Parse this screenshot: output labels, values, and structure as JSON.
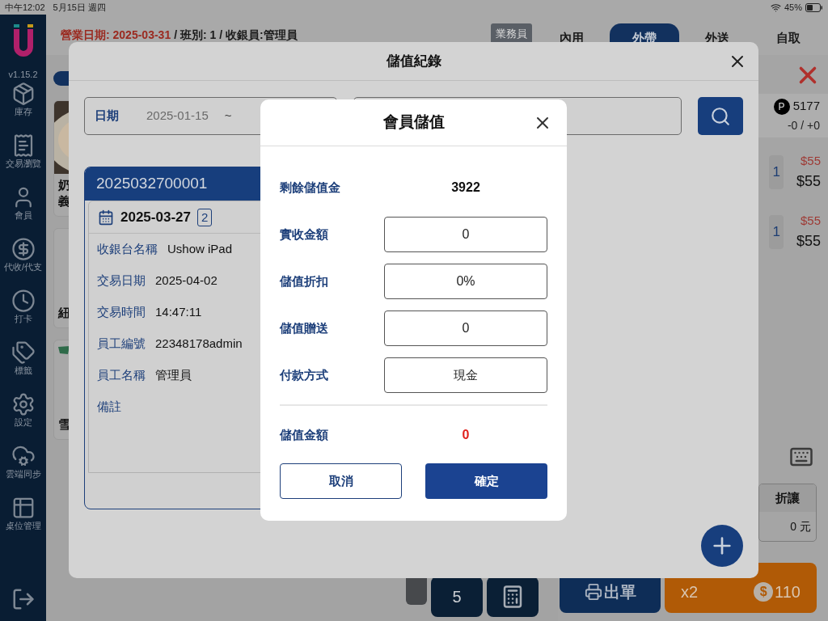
{
  "status_bar": {
    "time": "中午12:02",
    "date": "5月15日 週四",
    "battery": "45%"
  },
  "sidebar": {
    "version": "v1.15.2",
    "items": [
      {
        "label": "庫存",
        "kind": "stock"
      },
      {
        "label": "交易瀏覽",
        "kind": "receipt"
      },
      {
        "label": "會員",
        "kind": "member"
      },
      {
        "label": "代收/代支",
        "kind": "money"
      },
      {
        "label": "打卡",
        "kind": "clock"
      },
      {
        "label": "標籤",
        "kind": "tag"
      },
      {
        "label": "設定",
        "kind": "settings"
      },
      {
        "label": "雲端同步",
        "kind": "cloud"
      },
      {
        "label": "桌位管理",
        "kind": "table"
      }
    ]
  },
  "header": {
    "business_date": "營業日期: 2025-03-31",
    "info": "/ 班別: 1 / 收銀員:管理員",
    "staff_button": "業務員",
    "tabs": [
      {
        "label": "內用",
        "selected": false
      },
      {
        "label": "外帶",
        "selected": true
      },
      {
        "label": "外送",
        "selected": false
      },
      {
        "label": "自取",
        "selected": false
      }
    ]
  },
  "products": [
    {
      "kind": "picture",
      "lines": [
        "奶",
        "義"
      ]
    },
    {
      "kind": "plain",
      "lines": [
        "紐"
      ]
    },
    {
      "kind": "logo",
      "lines": [
        "雪"
      ]
    }
  ],
  "order": {
    "points_badge": "P",
    "points": "5177",
    "points_change": "-0 / +0",
    "items": [
      {
        "qty": "1",
        "original_price": "$55",
        "price": "$55"
      },
      {
        "qty": "1",
        "original_price": "$55",
        "price": "$55"
      }
    ],
    "discount": {
      "label": "折讓",
      "value": "0 元"
    },
    "print_button": "出單",
    "checkout": {
      "count": "x2",
      "coin": "$",
      "total": "110"
    }
  },
  "keypad": {
    "number": "5"
  },
  "records_dialog": {
    "title": "儲值紀錄",
    "date_filter": {
      "label": "日期",
      "from": "2025-01-15",
      "separator": "~"
    },
    "record": {
      "number": "2025032700001",
      "date": "2025-03-27",
      "count": "2",
      "fields": [
        {
          "label": "收銀台名稱",
          "value": "Ushow iPad"
        },
        {
          "label": "交易日期",
          "value": "2025-04-02"
        },
        {
          "label": "交易時間",
          "value": "14:47:11"
        },
        {
          "label": "員工編號",
          "value": "22348178admin"
        },
        {
          "label": "員工名稱",
          "value": "管理員"
        },
        {
          "label": "備註"
        }
      ]
    }
  },
  "topup_dialog": {
    "title": "會員儲值",
    "rows": [
      {
        "kind": "text",
        "label": "剩餘儲值金",
        "value": "3922"
      },
      {
        "kind": "input",
        "label": "實收金額",
        "value": "0"
      },
      {
        "kind": "input",
        "label": "儲值折扣",
        "value": "0%"
      },
      {
        "kind": "input",
        "label": "儲值贈送",
        "value": "0"
      },
      {
        "kind": "select",
        "label": "付款方式",
        "value": "現金"
      }
    ],
    "total": {
      "label": "儲值金額",
      "value": "0"
    },
    "cancel_button": "取消",
    "confirm_button": "確定"
  }
}
